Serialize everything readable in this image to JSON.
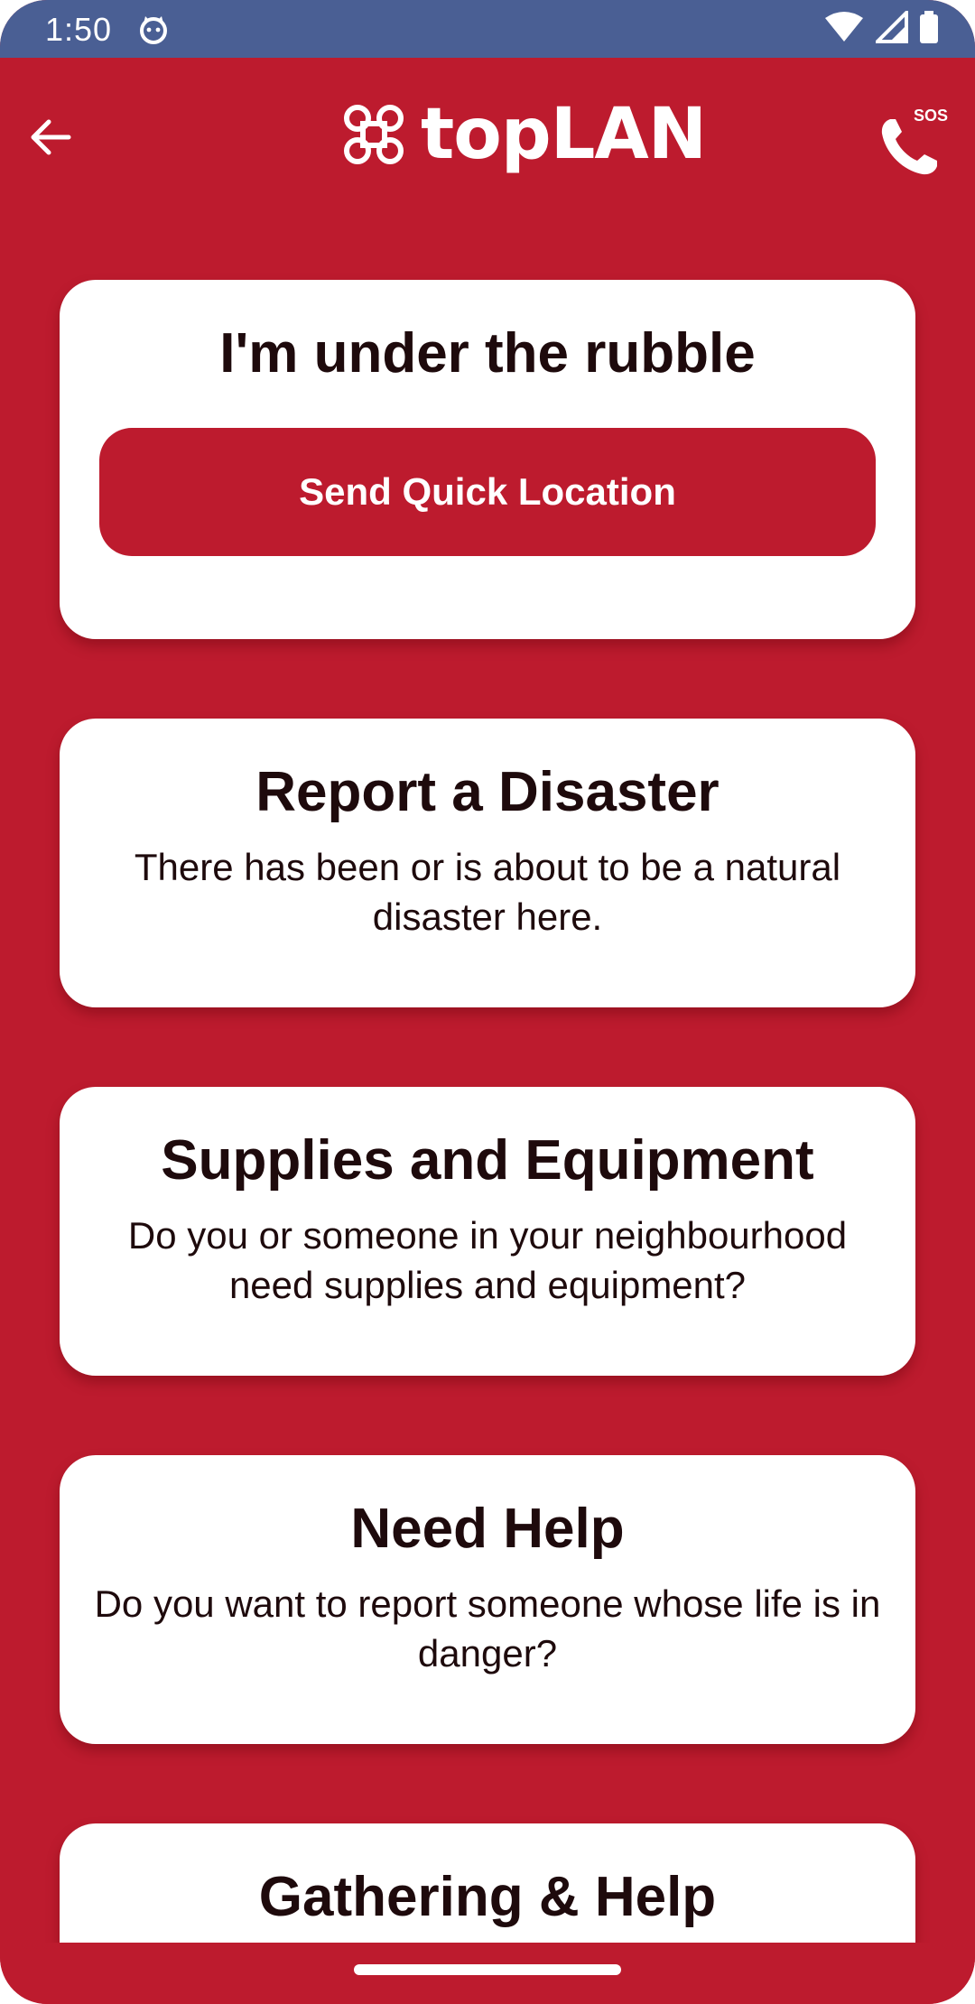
{
  "status_bar": {
    "time": "1:50",
    "icons": [
      "face-icon",
      "wifi-icon",
      "signal-icon",
      "battery-icon"
    ]
  },
  "app_bar": {
    "back_icon": "arrow-left-icon",
    "logo_text": "topLAN",
    "sos_label": "SOS",
    "sos_icon": "phone-icon"
  },
  "cards": [
    {
      "title": "I'm under the rubble",
      "button_label": "Send Quick Location"
    },
    {
      "title": "Report a Disaster",
      "description": "There has been or is about to be a natural disaster here."
    },
    {
      "title": "Supplies and Equipment",
      "description": "Do you or someone in your neighbourhood need supplies and equipment?"
    },
    {
      "title": "Need Help",
      "description": "Do you want to report someone whose life is in danger?"
    },
    {
      "title": "Gathering & Help"
    }
  ],
  "colors": {
    "brand_red": "#bd1b2e",
    "status_bar": "#4a5f94",
    "card_bg": "#ffffff",
    "text_dark": "#1e0a0c"
  }
}
